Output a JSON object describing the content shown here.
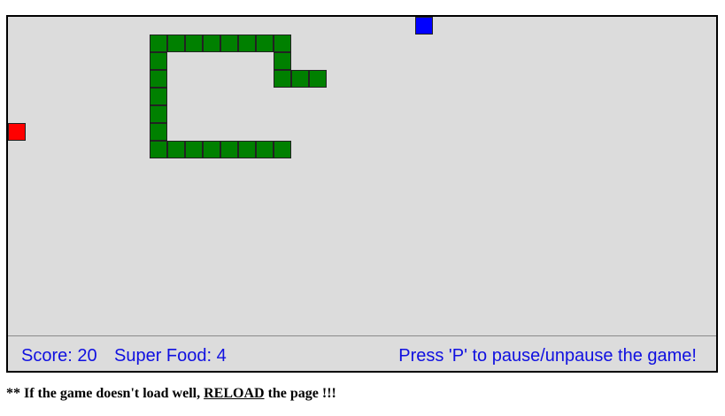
{
  "game": {
    "colors": {
      "board_background": "#dcdcdc",
      "snake": "#008000",
      "food": "#ff0000",
      "super_food": "#0000ff",
      "status_text": "#1010e0"
    },
    "grid_units": {
      "columns": 40,
      "rows": 18
    },
    "snake_segments": [
      {
        "col": 8,
        "row": 1
      },
      {
        "col": 9,
        "row": 1
      },
      {
        "col": 10,
        "row": 1
      },
      {
        "col": 11,
        "row": 1
      },
      {
        "col": 12,
        "row": 1
      },
      {
        "col": 13,
        "row": 1
      },
      {
        "col": 14,
        "row": 1
      },
      {
        "col": 15,
        "row": 1
      },
      {
        "col": 15,
        "row": 2
      },
      {
        "col": 15,
        "row": 3
      },
      {
        "col": 16,
        "row": 3
      },
      {
        "col": 17,
        "row": 3
      },
      {
        "col": 8,
        "row": 2
      },
      {
        "col": 8,
        "row": 3
      },
      {
        "col": 8,
        "row": 4
      },
      {
        "col": 8,
        "row": 5
      },
      {
        "col": 8,
        "row": 6
      },
      {
        "col": 8,
        "row": 7
      },
      {
        "col": 9,
        "row": 7
      },
      {
        "col": 10,
        "row": 7
      },
      {
        "col": 11,
        "row": 7
      },
      {
        "col": 12,
        "row": 7
      },
      {
        "col": 13,
        "row": 7
      },
      {
        "col": 14,
        "row": 7
      },
      {
        "col": 15,
        "row": 7
      }
    ],
    "food": {
      "col": 0,
      "row": 6
    },
    "super_food": {
      "col": 23,
      "row": 0
    }
  },
  "status": {
    "score_text": "Score: 20",
    "super_food_text": "Super Food: 4",
    "pause_hint": "Press 'P' to pause/unpause the game!"
  },
  "footer": {
    "prefix": "** If the game doesn't load well, ",
    "reload_label": "RELOAD",
    "suffix": " the page !!!"
  }
}
